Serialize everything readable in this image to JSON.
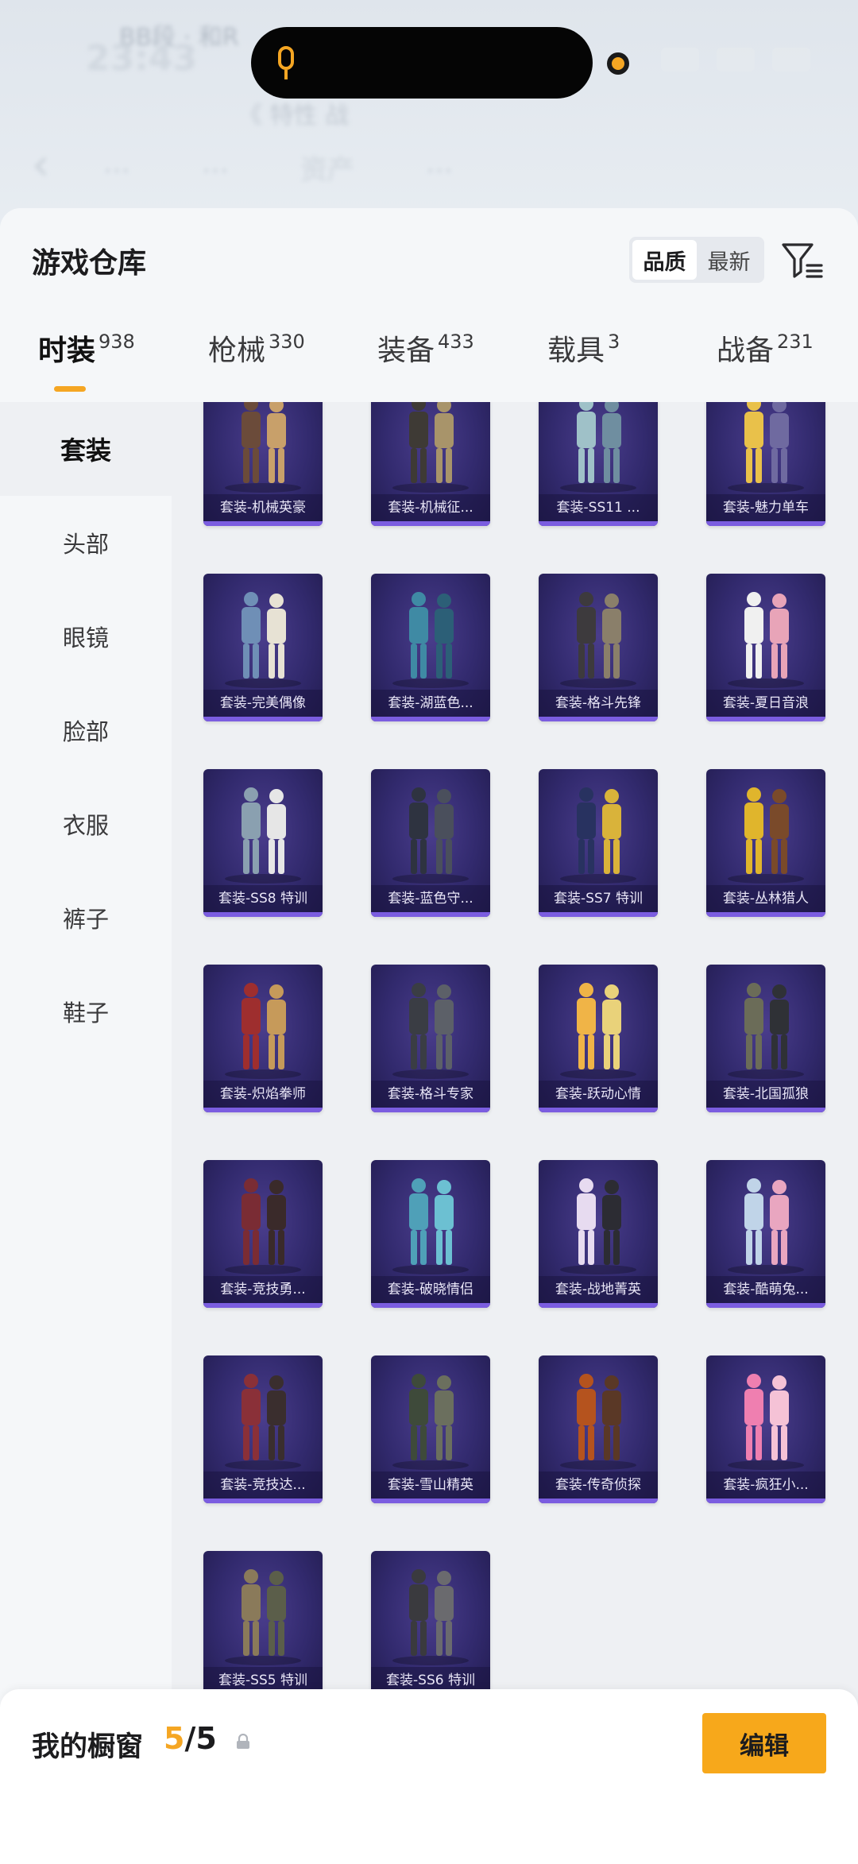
{
  "background": {
    "time": "23:43",
    "sub_text": "BB段 · 和R",
    "row1": "《 特性    战",
    "tabs": [
      "…",
      "…",
      "资产",
      "…"
    ]
  },
  "sheet": {
    "title": "游戏仓库",
    "sort": {
      "options": [
        "品质",
        "最新"
      ],
      "selected": "品质"
    },
    "filter_icon": "filter-icon"
  },
  "tabs": [
    {
      "label": "时装",
      "count": "938",
      "active": true
    },
    {
      "label": "枪械",
      "count": "330",
      "active": false
    },
    {
      "label": "装备",
      "count": "433",
      "active": false
    },
    {
      "label": "载具",
      "count": "3",
      "active": false
    },
    {
      "label": "战备",
      "count": "231",
      "active": false
    }
  ],
  "side_menu": [
    {
      "label": "套装",
      "active": true
    },
    {
      "label": "头部",
      "active": false
    },
    {
      "label": "眼镜",
      "active": false
    },
    {
      "label": "脸部",
      "active": false
    },
    {
      "label": "衣服",
      "active": false
    },
    {
      "label": "裤子",
      "active": false
    },
    {
      "label": "鞋子",
      "active": false
    }
  ],
  "items": [
    {
      "label": "套装-机械英豪"
    },
    {
      "label": "套装-机械征..."
    },
    {
      "label": "套装-SS11 ..."
    },
    {
      "label": "套装-魅力单车"
    },
    {
      "label": "套装-完美偶像"
    },
    {
      "label": "套装-湖蓝色..."
    },
    {
      "label": "套装-格斗先锋"
    },
    {
      "label": "套装-夏日音浪"
    },
    {
      "label": "套装-SS8 特训"
    },
    {
      "label": "套装-蓝色守..."
    },
    {
      "label": "套装-SS7 特训"
    },
    {
      "label": "套装-丛林猎人"
    },
    {
      "label": "套装-炽焰拳师"
    },
    {
      "label": "套装-格斗专家"
    },
    {
      "label": "套装-跃动心情"
    },
    {
      "label": "套装-北国孤狼"
    },
    {
      "label": "套装-竞技勇..."
    },
    {
      "label": "套装-破晓情侣"
    },
    {
      "label": "套装-战地菁英"
    },
    {
      "label": "套装-酷萌兔..."
    },
    {
      "label": "套装-竞技达..."
    },
    {
      "label": "套装-雪山精英"
    },
    {
      "label": "套装-传奇侦探"
    },
    {
      "label": "套装-疯狂小..."
    },
    {
      "label": "套装-SS5 特训"
    },
    {
      "label": "套装-SS6 特训"
    }
  ],
  "colors": {
    "accent": "#f5a623",
    "card_bg": "#322a6e",
    "card_border": "#7b5de0"
  },
  "showcase": {
    "title": "我的橱窗",
    "current": "5",
    "total": "/5",
    "lock_icon": "lock-icon",
    "edit_label": "编辑"
  },
  "fab_icon": "share-icon"
}
